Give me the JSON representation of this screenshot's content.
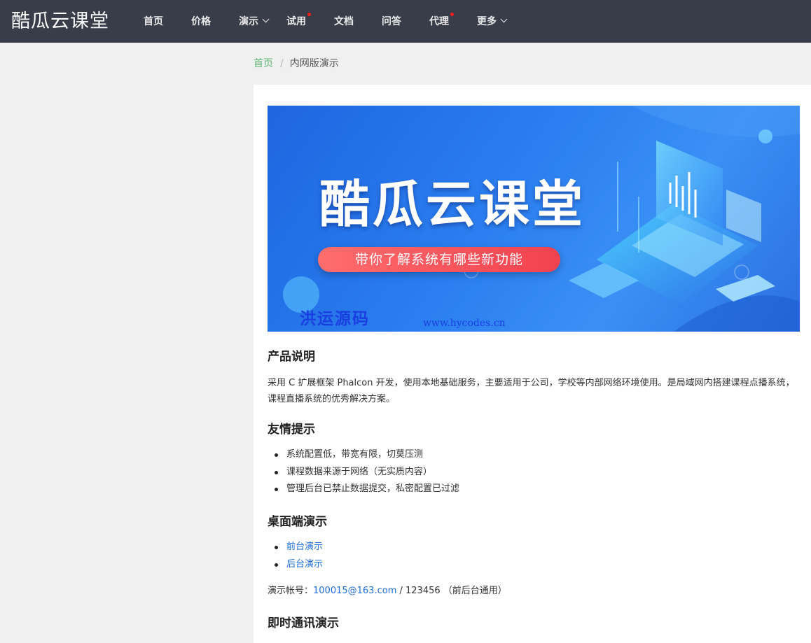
{
  "header": {
    "logo": "酷瓜云课堂",
    "nav": [
      {
        "label": "首页"
      },
      {
        "label": "价格"
      },
      {
        "label": "演示"
      },
      {
        "label": "试用"
      },
      {
        "label": "文档"
      },
      {
        "label": "问答"
      },
      {
        "label": "代理"
      },
      {
        "label": "更多"
      }
    ]
  },
  "breadcrumb": {
    "home": "首页",
    "separator": "/",
    "current": "内网版演示"
  },
  "banner": {
    "title": "酷瓜云课堂",
    "subtitle": "带你了解系统有哪些新功能",
    "watermark_cn": "洪运源码",
    "watermark_url": "www.hycodes.cn"
  },
  "sections": {
    "product": {
      "heading": "产品说明",
      "text": "采用 C 扩展框架 Phalcon 开发，使用本地基础服务，主要适用于公司，学校等内部网络环境使用。是局域网内搭建课程点播系统，课程直播系统的优秀解决方案。"
    },
    "tips": {
      "heading": "友情提示",
      "items": [
        "系统配置低，带宽有限，切莫压测",
        "课程数据来源于网络（无实质内容）",
        "管理后台已禁止数据提交，私密配置已过滤"
      ]
    },
    "desktop": {
      "heading": "桌面端演示",
      "links": [
        "前台演示",
        "后台演示"
      ],
      "account_label": "演示帐号：",
      "account_email": "100015@163.com",
      "account_rest": " / 123456 （前后台通用）"
    },
    "im": {
      "heading": "即时通讯演示"
    }
  },
  "colors": {
    "header_bg": "#393d49",
    "breadcrumb_home": "#5fb878",
    "link": "#1e6fd9",
    "nav_dot": "#ff1b1b"
  }
}
